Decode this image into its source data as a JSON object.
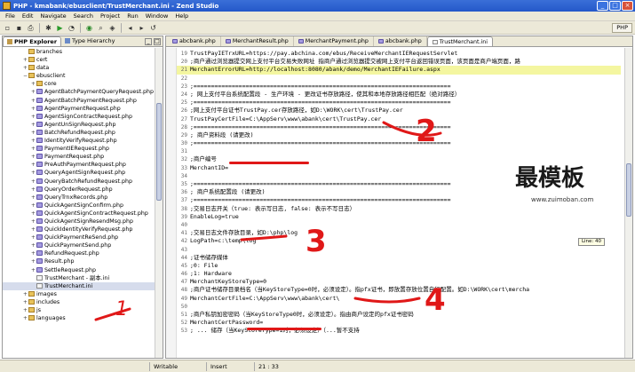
{
  "window": {
    "title": "PHP - kmabank/ebusclient/TrustMerchant.ini - Zend Studio"
  },
  "menu": [
    "File",
    "Edit",
    "Navigate",
    "Search",
    "Project",
    "Run",
    "Window",
    "Help"
  ],
  "perspective": {
    "label": "PHP"
  },
  "left_panel": {
    "tabs": [
      "PHP Explorer",
      "Type Hierarchy"
    ],
    "tree": [
      {
        "label": "branches",
        "icon": "folder",
        "depth": 2,
        "toggle": ""
      },
      {
        "label": "cert",
        "icon": "folder",
        "depth": 2,
        "toggle": "+"
      },
      {
        "label": "data",
        "icon": "folder",
        "depth": 2,
        "toggle": "+"
      },
      {
        "label": "ebusclient",
        "icon": "folder",
        "depth": 2,
        "toggle": "−"
      },
      {
        "label": "core",
        "icon": "folder",
        "depth": 3,
        "toggle": "+"
      },
      {
        "label": "AgentBatchPaymentQueryRequest.php",
        "icon": "php",
        "depth": 3,
        "toggle": "+"
      },
      {
        "label": "AgentBatchPaymentRequest.php",
        "icon": "php",
        "depth": 3,
        "toggle": "+"
      },
      {
        "label": "AgentPaymentRequest.php",
        "icon": "php",
        "depth": 3,
        "toggle": "+"
      },
      {
        "label": "AgentSignContractRequest.php",
        "icon": "php",
        "depth": 3,
        "toggle": "+"
      },
      {
        "label": "AgentUnSignRequest.php",
        "icon": "php",
        "depth": 3,
        "toggle": "+"
      },
      {
        "label": "BatchRefundRequest.php",
        "icon": "php",
        "depth": 3,
        "toggle": "+"
      },
      {
        "label": "IdentityVerifyRequest.php",
        "icon": "php",
        "depth": 3,
        "toggle": "+"
      },
      {
        "label": "PaymentIERequest.php",
        "icon": "php",
        "depth": 3,
        "toggle": "+"
      },
      {
        "label": "PaymentRequest.php",
        "icon": "php",
        "depth": 3,
        "toggle": "+"
      },
      {
        "label": "PreAuthPaymentRequest.php",
        "icon": "php",
        "depth": 3,
        "toggle": "+"
      },
      {
        "label": "QueryAgentSignRequest.php",
        "icon": "php",
        "depth": 3,
        "toggle": "+"
      },
      {
        "label": "QueryBatchRefundRequest.php",
        "icon": "php",
        "depth": 3,
        "toggle": "+"
      },
      {
        "label": "QueryOrderRequest.php",
        "icon": "php",
        "depth": 3,
        "toggle": "+"
      },
      {
        "label": "QueryTrnxRecords.php",
        "icon": "php",
        "depth": 3,
        "toggle": "+"
      },
      {
        "label": "QuickAgentSignConfirm.php",
        "icon": "php",
        "depth": 3,
        "toggle": "+"
      },
      {
        "label": "QuickAgentSignContractRequest.php",
        "icon": "php",
        "depth": 3,
        "toggle": "+"
      },
      {
        "label": "QuickAgentSignResendMsg.php",
        "icon": "php",
        "depth": 3,
        "toggle": "+"
      },
      {
        "label": "QuickIdentityVerifyRequest.php",
        "icon": "php",
        "depth": 3,
        "toggle": "+"
      },
      {
        "label": "QuickPaymentReSend.php",
        "icon": "php",
        "depth": 3,
        "toggle": "+"
      },
      {
        "label": "QuickPaymentSend.php",
        "icon": "php",
        "depth": 3,
        "toggle": "+"
      },
      {
        "label": "RefundRequest.php",
        "icon": "php",
        "depth": 3,
        "toggle": "+"
      },
      {
        "label": "Result.php",
        "icon": "php",
        "depth": 3,
        "toggle": "+"
      },
      {
        "label": "SettleRequest.php",
        "icon": "php",
        "depth": 3,
        "toggle": "+"
      },
      {
        "label": "TrustMerchant - 副本.ini",
        "icon": "ini",
        "depth": 3,
        "toggle": ""
      },
      {
        "label": "TrustMerchant.ini",
        "icon": "ini",
        "depth": 3,
        "toggle": "",
        "selected": true
      },
      {
        "label": "images",
        "icon": "folder",
        "depth": 2,
        "toggle": "+"
      },
      {
        "label": "includes",
        "icon": "folder",
        "depth": 2,
        "toggle": "+"
      },
      {
        "label": "js",
        "icon": "folder",
        "depth": 2,
        "toggle": "+"
      },
      {
        "label": "languages",
        "icon": "folder",
        "depth": 2,
        "toggle": "+"
      }
    ]
  },
  "editor": {
    "tabs": [
      "abcbank.php",
      "MerchantResult.php",
      "MerchantPayment.php",
      "abcbank.php",
      "TrustMerchant.ini"
    ],
    "active_tab": 4,
    "lines": [
      {
        "n": "19",
        "text": "TrustPayIETrxURL=https://pay.abchina.com/ebus/ReceiveMerchantIERequestServlet"
      },
      {
        "n": "20",
        "text": ";商户通过浏览器提交网上支付平台交易失败网址 指商户通过浏览器提交被网上支付平台返回错误页面，该页面是商户端页面，路"
      },
      {
        "n": "21",
        "text": "MerchantErrorURL=http://localhost:8080/abank/demo/MerchantIEFailure.aspx",
        "highlight": true
      },
      {
        "n": "22",
        "text": ""
      },
      {
        "n": "23",
        "text": ";=========================================================================="
      },
      {
        "n": "24",
        "text": ";  网上支付平台系统配置段 - 生产环境 - 更改证书存放路径，使其和本地存放路径相匹配（绝对路径）"
      },
      {
        "n": "25",
        "text": ";=========================================================================="
      },
      {
        "n": "26",
        "text": ";网上支付平台证书TrustPay.cer存放路径，如D:\\WORK\\cert\\TrustPay.cer"
      },
      {
        "n": "27",
        "text": "TrustPayCertFile=C:\\AppServ\\www\\abank\\cert\\TrustPay.cer"
      },
      {
        "n": "28",
        "text": ";=========================================================================="
      },
      {
        "n": "29",
        "text": ";  商户资料段 (请更改)"
      },
      {
        "n": "30",
        "text": ";=========================================================================="
      },
      {
        "n": "31",
        "text": ""
      },
      {
        "n": "32",
        "text": ";商户编号"
      },
      {
        "n": "33",
        "text": "MerchantID="
      },
      {
        "n": "34",
        "text": ""
      },
      {
        "n": "35",
        "text": ";=========================================================================="
      },
      {
        "n": "36",
        "text": ";  商户系统配置段 (请更改)"
      },
      {
        "n": "37",
        "text": ";=========================================================================="
      },
      {
        "n": "38",
        "text": ";交易日志开关（true: 表示写日志, false: 表示不写日志）"
      },
      {
        "n": "39",
        "text": "EnableLog=true"
      },
      {
        "n": "40",
        "text": ""
      },
      {
        "n": "41",
        "text": ";交易日志文件存放目录，如D:\\php\\log"
      },
      {
        "n": "42",
        "text": "LogPath=c:\\temp\\log"
      },
      {
        "n": "43",
        "text": ""
      },
      {
        "n": "44",
        "text": ";证书储存媒体"
      },
      {
        "n": "45",
        "text": ";0: File"
      },
      {
        "n": "46",
        "text": ";1: Hardware"
      },
      {
        "n": "47",
        "text": "MerchantKeyStoreType=0"
      },
      {
        "n": "48",
        "text": ";商户证书储存目录档名（当KeyStoreType=0时，必须设定）。指pfx证书，即放置存放位置自行配置。如D:\\WORK\\cert\\mercha"
      },
      {
        "n": "49",
        "text": "MerchantCertFile=C:\\AppServ\\www\\abank\\cert\\"
      },
      {
        "n": "50",
        "text": ""
      },
      {
        "n": "51",
        "text": ";商户私钥加密密码（当KeyStoreType0时，必须设定）。指由商户设定的pfx证书密码"
      },
      {
        "n": "52",
        "text": "MerchantCertPassword="
      },
      {
        "n": "53",
        "text": "  ;  ...  储存（当KeyStoreType=1时，必须设定）（...暂不支持"
      }
    ]
  },
  "annotations": [
    "1",
    "2",
    "3",
    "4"
  ],
  "line_badge": "Line: 40",
  "watermark": {
    "title": "最模板",
    "url": "www.zuimoban.com"
  },
  "status": {
    "mode": "Writable",
    "insert": "Insert",
    "position": "21 : 33"
  },
  "colors": {
    "annotation_red": "#e01818",
    "highlight_line": "#f4f6a0",
    "title_blue": "#2458c9"
  }
}
